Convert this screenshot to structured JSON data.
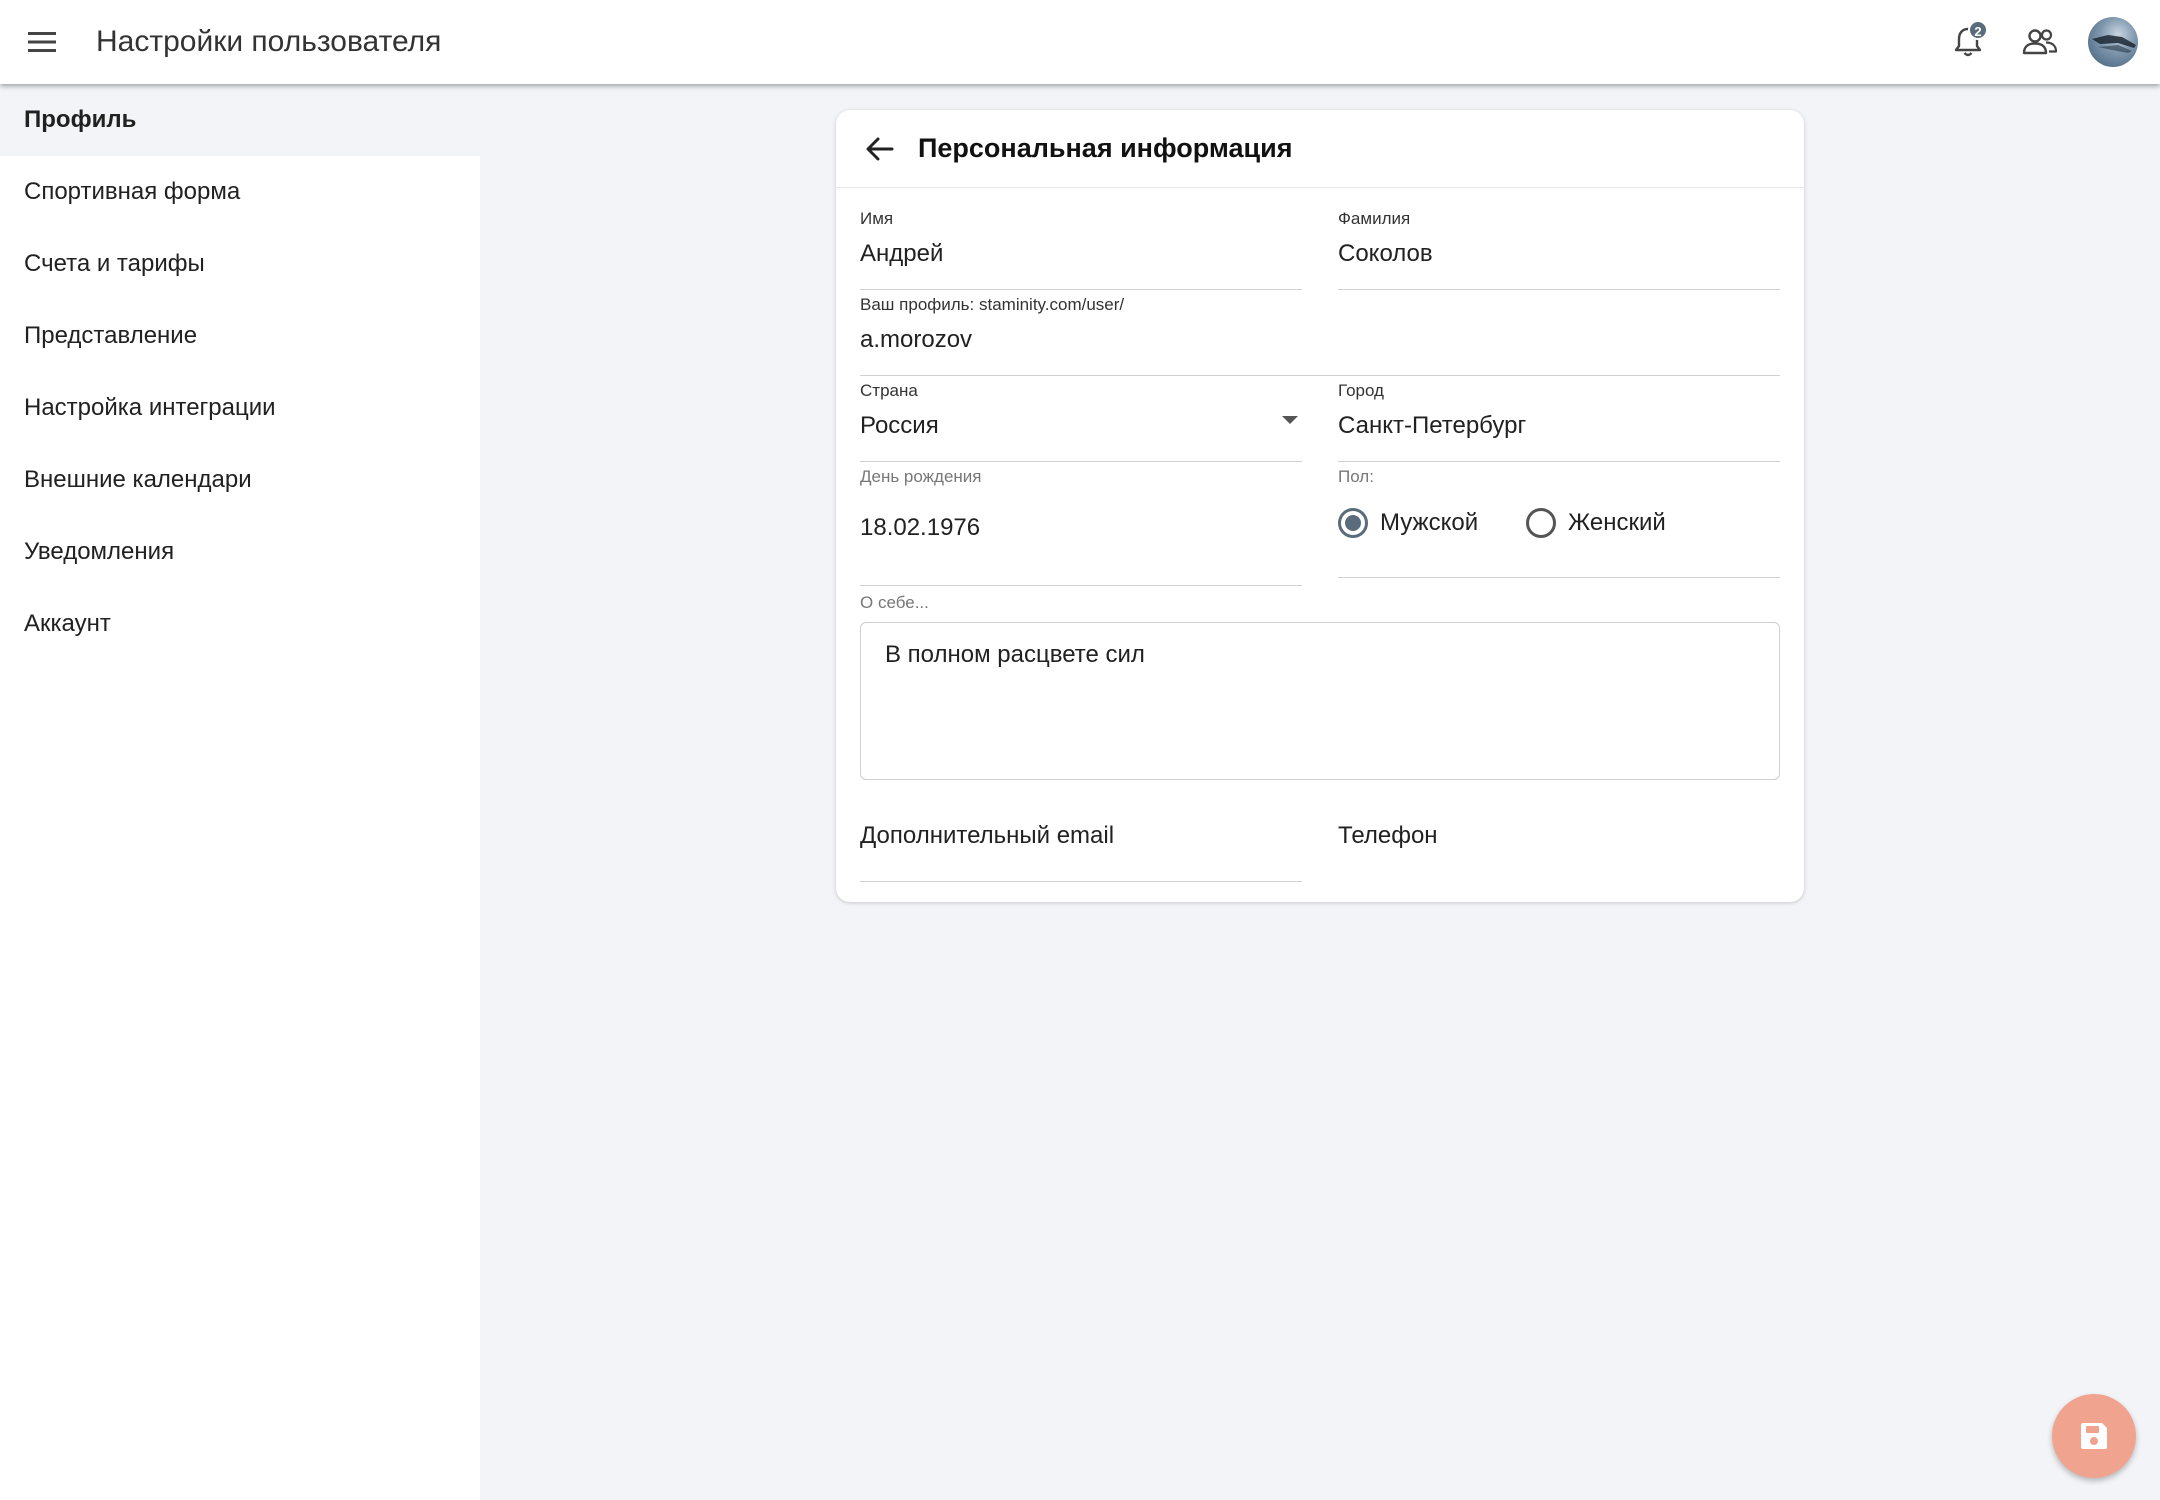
{
  "header": {
    "title": "Настройки пользователя",
    "notifications_badge": "2",
    "icons": [
      "menu-icon",
      "bell-icon",
      "users-icon",
      "avatar"
    ]
  },
  "sidebar": {
    "items": [
      {
        "label": "Профиль",
        "active": true
      },
      {
        "label": "Спортивная форма"
      },
      {
        "label": "Счета и тарифы"
      },
      {
        "label": "Представление"
      },
      {
        "label": "Настройка интеграции"
      },
      {
        "label": "Внешние календари"
      },
      {
        "label": "Уведомления"
      },
      {
        "label": "Аккаунт"
      }
    ]
  },
  "card": {
    "title": "Персональная информация",
    "first_name": {
      "label": "Имя",
      "value": "Андрей"
    },
    "last_name": {
      "label": "Фамилия",
      "value": "Соколов"
    },
    "profile": {
      "label": "Ваш профиль: staminity.com/user/",
      "value": "a.morozov"
    },
    "country": {
      "label": "Страна",
      "value": "Россия"
    },
    "city": {
      "label": "Город",
      "value": "Санкт-Петербург"
    },
    "birthday": {
      "label": "День рождения",
      "value": "18.02.1976"
    },
    "gender": {
      "label": "Пол:",
      "male": "Мужской",
      "female": "Женский",
      "selected": "male"
    },
    "about": {
      "label": "О себе...",
      "value": "В полном расцвете сил"
    },
    "extra_email": {
      "placeholder": "Дополнительный email"
    },
    "phone": {
      "placeholder": "Телефон"
    }
  },
  "colors": {
    "accent": "#5a6b7b",
    "fab": "#f0a48f",
    "background": "#f3f4f8"
  }
}
